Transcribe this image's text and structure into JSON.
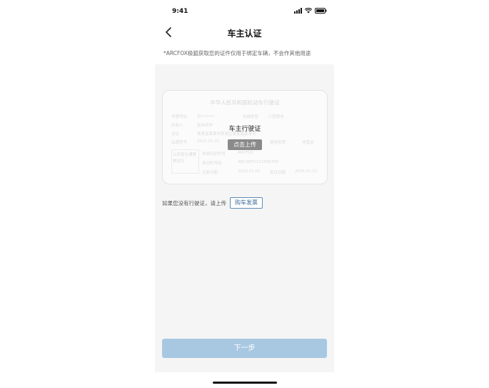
{
  "status_bar": {
    "time": "9:41"
  },
  "nav": {
    "title": "车主认证"
  },
  "notice": "*ARCFOX极狐获取您的证件仅用于绑定车辆，不会作其他用途",
  "card": {
    "title": "中华人民共和国机动车行驶证",
    "overlay_label": "车主行驶证",
    "upload_label": "点击上传",
    "background_text": {
      "plate_label": "号牌号码",
      "plate_value": "京*******",
      "type_label": "车辆类型",
      "type_value": "小型轿车",
      "owner_label": "所有人",
      "owner_value": "张伟同学",
      "address_label": "住址",
      "address_value": "某某省某某市某某区某某路某某号",
      "use_label": "使用性质",
      "use_value": "非营运",
      "model_label": "品牌型号",
      "model_value": "2021.01.01",
      "seal": "公安局交通警察支队",
      "vin_label": "车辆识别代号",
      "vin_value": "ARCFOX",
      "engine_label": "发动机号码",
      "engine_value": "ARCDEF0123456789",
      "reg_label": "注册日期",
      "reg_value": "2019.01.01",
      "issue_label": "发证日期",
      "issue_value": "2024.01.01"
    }
  },
  "invoice": {
    "prompt": "如果您没有行驶证，请上传",
    "button_label": "购车发票"
  },
  "next_button": {
    "label": "下一步"
  },
  "colors": {
    "accent_outline": "#5b8bb8",
    "next_button_bg": "#a8c8e2",
    "content_bg": "#f5f5f5"
  }
}
